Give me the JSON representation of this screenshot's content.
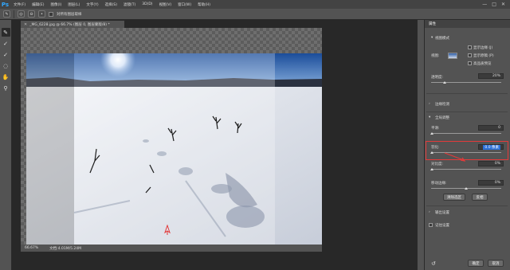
{
  "app": {
    "logo": "Ps"
  },
  "menu": [
    "文件(F)",
    "编辑(E)",
    "图像(I)",
    "图层(L)",
    "文字(Y)",
    "选择(S)",
    "滤镜(T)",
    "3D(D)",
    "视图(V)",
    "窗口(W)",
    "帮助(H)"
  ],
  "window_controls": [
    "—",
    "□",
    "✕"
  ],
  "options": {
    "checkbox_label": "对所有图层取样"
  },
  "document": {
    "tab_title": "_MG_6228.jpg @ 66.7% (图层 0, 图层蒙版/8) *",
    "zoom": "66.67%",
    "doc_info": "文档:4.01M/5.24M"
  },
  "properties": {
    "tab": "属性",
    "view_mode_header": "视图模式",
    "view_label": "视图:",
    "show_edge": "显示边缘 (J)",
    "show_original": "显示原稿 (P)",
    "hq_preview": "高品质预览",
    "opacity_label": "透明度:",
    "opacity_value": "20%",
    "edge_detect": "边缘检测",
    "global_refine": "全局调整",
    "smooth_label": "平滑:",
    "smooth_value": "0",
    "feather_label": "羽化:",
    "feather_value": "0.0 像素",
    "contrast_label": "对比度:",
    "contrast_value": "0%",
    "shift_edge_label": "移动边缘:",
    "shift_edge_value": "0%",
    "clear_selection": "清除选区",
    "invert": "反相",
    "output_settings": "输出设置",
    "remember_settings": "记住设置",
    "ok": "确定",
    "cancel": "取消"
  },
  "colors": {
    "highlight": "#e23a3a",
    "selection": "#2b6fd6"
  }
}
